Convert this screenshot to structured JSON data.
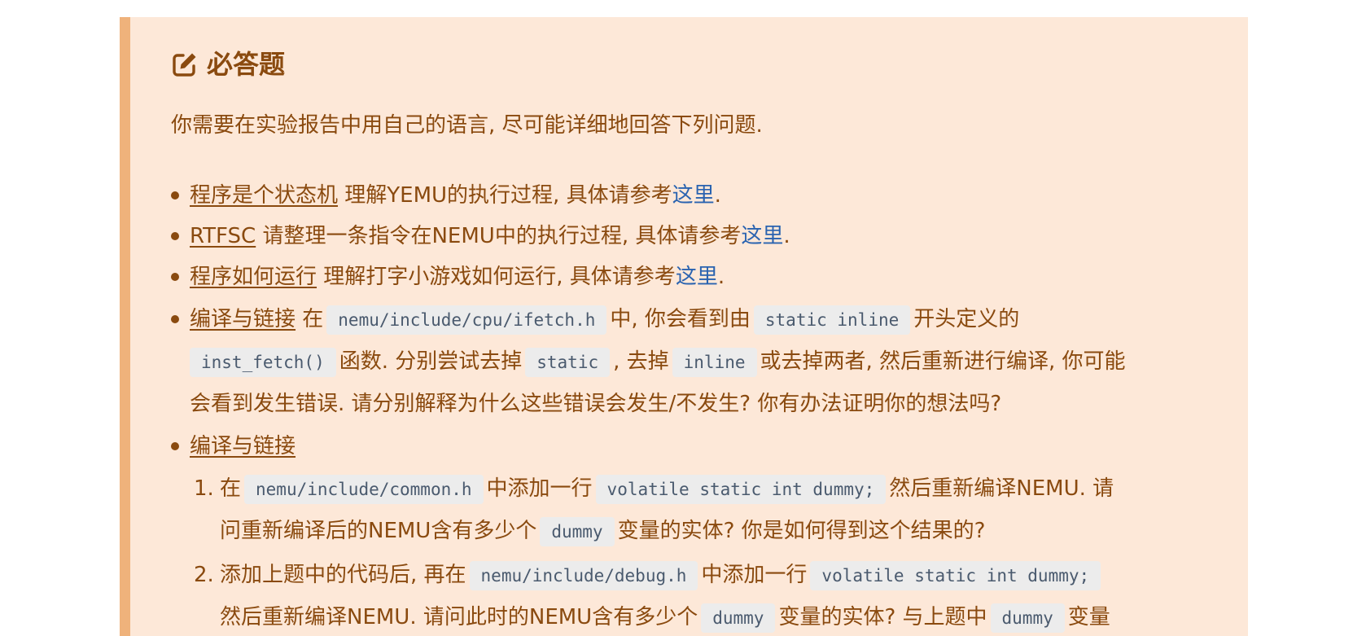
{
  "callout": {
    "title": "必答题",
    "intro": "你需要在实验报告中用自己的语言, 尽可能详细地回答下列问题."
  },
  "items": {
    "i1": {
      "term": "程序是个状态机",
      "text": " 理解YEMU的执行过程, 具体请参考",
      "link": "这里",
      "end": "."
    },
    "i2": {
      "term": "RTFSC",
      "text": " 请整理一条指令在NEMU中的执行过程, 具体请参考",
      "link": "这里",
      "end": "."
    },
    "i3": {
      "term": "程序如何运行",
      "text": " 理解打字小游戏如何运行, 具体请参考",
      "link": "这里",
      "end": "."
    },
    "i4": {
      "term": "编译与链接",
      "l1a": " 在",
      "code1": "nemu/include/cpu/ifetch.h",
      "l1b": "中, 你会看到由",
      "code2": "static inline",
      "l1c": "开头定义的",
      "code3": "inst_fetch()",
      "l2a": "函数. 分别尝试去掉",
      "code4": "static",
      "l2b": ", 去掉",
      "code5": "inline",
      "l2c": "或去掉两者, 然后重新进行编译, 你可能",
      "l3": "会看到发生错误. 请分别解释为什么这些错误会发生/不发生? 你有办法证明你的想法吗?"
    },
    "i5": {
      "term": "编译与链接"
    }
  },
  "sub": {
    "s1": {
      "num": "1.",
      "a": "在",
      "code1": "nemu/include/common.h",
      "b": "中添加一行",
      "code2": "volatile static int dummy;",
      "c": "然后重新编译NEMU. 请",
      "d": "问重新编译后的NEMU含有多少个",
      "code3": "dummy",
      "e": "变量的实体? 你是如何得到这个结果的?"
    },
    "s2": {
      "num": "2.",
      "a": "添加上题中的代码后, 再在",
      "code1": "nemu/include/debug.h",
      "b": "中添加一行",
      "code2": "volatile static int dummy;",
      "c": "然后重新编译NEMU. 请问此时的NEMU含有多少个",
      "code3": "dummy",
      "d": "变量的实体? 与上题中",
      "code4": "dummy",
      "e": "变量"
    }
  }
}
